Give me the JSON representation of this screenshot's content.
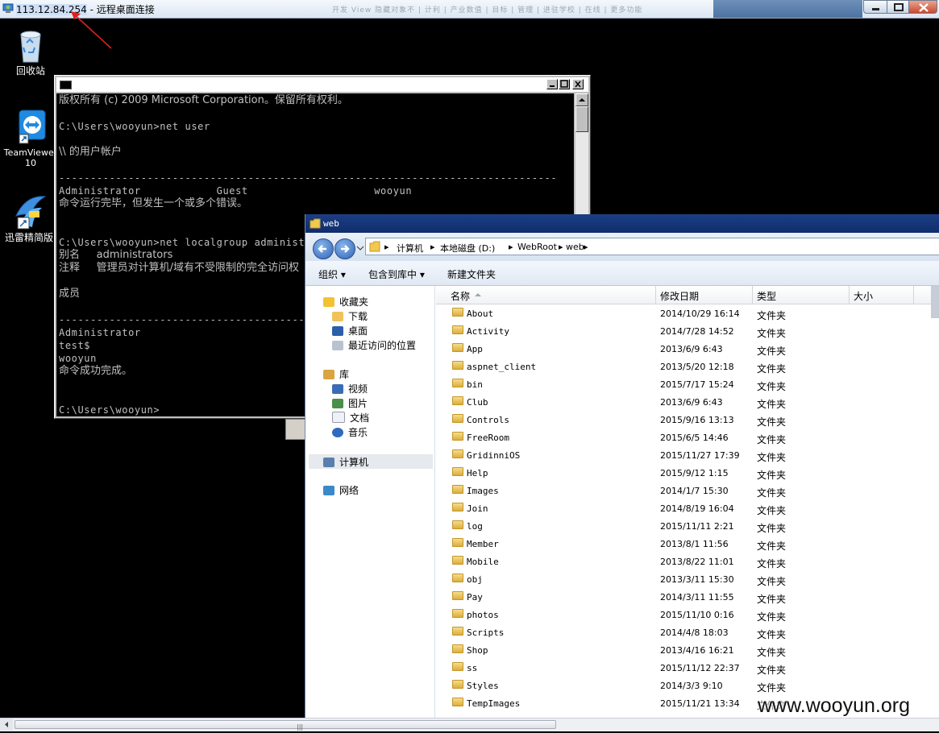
{
  "rdp": {
    "host": "113.12.84.254",
    "title_suffix": " - 远程桌面连接",
    "faded_title": "开发 View 隐藏对象不 | 计利 | 产业数值 | 目标 | 管理 | 进驻学校 | 在线 | 更多功能"
  },
  "desktop": {
    "icons": [
      {
        "label": "回收站",
        "icon": "recycle-bin-icon"
      },
      {
        "label": "TeamViewer 10",
        "line1": "TeamViewer",
        "line2": "10",
        "icon": "teamviewer-icon"
      },
      {
        "label": "迅雷精简版",
        "icon": "xunlei-icon"
      }
    ]
  },
  "cmd": {
    "lines": [
      {
        "text": "版权所有 (c) 2009 Microsoft Corporation。保留所有权利。"
      },
      {
        "text": ""
      },
      {
        "text": "C:\\Users\\wooyun>net user"
      },
      {
        "text": ""
      },
      {
        "text": "\\\\ 的用户帐户"
      },
      {
        "text": ""
      },
      {
        "text": "-------------------------------------------------------------------------------"
      },
      {
        "text": "Administrator            Guest                    wooyun"
      },
      {
        "text": "命令运行完毕，但发生一个或多个错误。"
      },
      {
        "text": ""
      },
      {
        "text": ""
      },
      {
        "text": "C:\\Users\\wooyun>net localgroup administrators"
      },
      {
        "text": "别名     administrators"
      },
      {
        "text": "注释     管理员对计算机/域有不受限制的完全访问权"
      },
      {
        "text": ""
      },
      {
        "text": "成员"
      },
      {
        "text": ""
      },
      {
        "text": "-------------------------------------------------------------------------------"
      },
      {
        "text": "Administrator"
      },
      {
        "text": "test$"
      },
      {
        "text": "wooyun"
      },
      {
        "text": "命令成功完成。"
      },
      {
        "text": ""
      },
      {
        "text": ""
      },
      {
        "text": "C:\\Users\\wooyun>"
      }
    ]
  },
  "explorer": {
    "title": "web",
    "breadcrumbs": [
      "计算机",
      "本地磁盘 (D:)",
      "WebRoot",
      "web"
    ],
    "toolbar": {
      "organize": "组织 ▾",
      "include": "包含到库中 ▾",
      "new_folder": "新建文件夹"
    },
    "nav": {
      "favorites": "收藏夹",
      "downloads": "下载",
      "desktop": "桌面",
      "recent": "最近访问的位置",
      "libraries": "库",
      "videos": "视频",
      "pictures": "图片",
      "documents": "文档",
      "music": "音乐",
      "computer": "计算机",
      "network": "网络"
    },
    "columns": {
      "name": "名称",
      "modified": "修改日期",
      "type": "类型",
      "size": "大小"
    },
    "files": [
      {
        "name": "About",
        "modified": "2014/10/29 16:14",
        "type": "文件夹"
      },
      {
        "name": "Activity",
        "modified": "2014/7/28 14:52",
        "type": "文件夹"
      },
      {
        "name": "App",
        "modified": "2013/6/9 6:43",
        "type": "文件夹"
      },
      {
        "name": "aspnet_client",
        "modified": "2013/5/20 12:18",
        "type": "文件夹"
      },
      {
        "name": "bin",
        "modified": "2015/7/17 15:24",
        "type": "文件夹"
      },
      {
        "name": "Club",
        "modified": "2013/6/9 6:43",
        "type": "文件夹"
      },
      {
        "name": "Controls",
        "modified": "2015/9/16 13:13",
        "type": "文件夹"
      },
      {
        "name": "FreeRoom",
        "modified": "2015/6/5 14:46",
        "type": "文件夹"
      },
      {
        "name": "GridinniOS",
        "modified": "2015/11/27 17:39",
        "type": "文件夹"
      },
      {
        "name": "Help",
        "modified": "2015/9/12 1:15",
        "type": "文件夹"
      },
      {
        "name": "Images",
        "modified": "2014/1/7 15:30",
        "type": "文件夹"
      },
      {
        "name": "Join",
        "modified": "2014/8/19 16:04",
        "type": "文件夹"
      },
      {
        "name": "log",
        "modified": "2015/11/11 2:21",
        "type": "文件夹"
      },
      {
        "name": "Member",
        "modified": "2013/8/1 11:56",
        "type": "文件夹"
      },
      {
        "name": "Mobile",
        "modified": "2013/8/22 11:01",
        "type": "文件夹"
      },
      {
        "name": "obj",
        "modified": "2013/3/11 15:30",
        "type": "文件夹"
      },
      {
        "name": "Pay",
        "modified": "2014/3/11 11:55",
        "type": "文件夹"
      },
      {
        "name": "photos",
        "modified": "2015/11/10 0:16",
        "type": "文件夹"
      },
      {
        "name": "Scripts",
        "modified": "2014/4/8 18:03",
        "type": "文件夹"
      },
      {
        "name": "Shop",
        "modified": "2013/4/16 16:21",
        "type": "文件夹"
      },
      {
        "name": "ss",
        "modified": "2015/11/12 22:37",
        "type": "文件夹"
      },
      {
        "name": "Styles",
        "modified": "2014/3/3 9:10",
        "type": "文件夹"
      },
      {
        "name": "TempImages",
        "modified": "2015/11/21 13:34",
        "type": "文件夹"
      }
    ]
  },
  "scrollbar": {
    "grip": "|||"
  },
  "watermark": "www.wooyun.org",
  "colors": {
    "desktop": "#000000",
    "cmd_text": "#c0c0c0",
    "explorer_title": "#0f2d6c",
    "folder": "#e6bd4c",
    "annotation": "#e02020"
  }
}
